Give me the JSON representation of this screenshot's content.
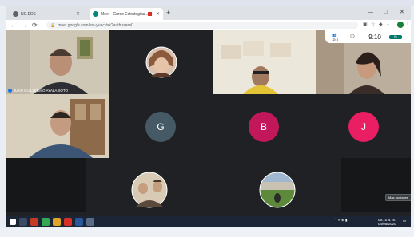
{
  "browser": {
    "tabs": [
      {
        "label": "NC.EDS",
        "active": false
      },
      {
        "label": "Meet - Curso Estrategias...",
        "active": true
      }
    ],
    "new_tab_label": "+",
    "window_controls": {
      "minimize": "—",
      "maximize": "□",
      "close": "✕"
    },
    "toolbar": {
      "back": "←",
      "forward": "→",
      "reload": "⟳",
      "url": "meet.google.com/src-yuec-tsk?authuser=0",
      "lock": "🔒"
    }
  },
  "meet": {
    "top_controls": {
      "participants_count": "(24)",
      "time": "9:10"
    },
    "participants": {
      "juan": {
        "name": "JUAN GUILLERMO AYALA SOTO"
      },
      "g": {
        "initial": "G",
        "color": "#455a64"
      },
      "b": {
        "initial": "B",
        "color": "#c2185b"
      },
      "j": {
        "initial": "J",
        "color": "#e91e63"
      }
    },
    "tooltip": "Más opciones"
  },
  "taskbar": {
    "time": "09:10 a. m.",
    "date": "04/05/2020"
  },
  "colors": {
    "meet_bg": "#202124",
    "tile_bg": "#3c4043",
    "accent_blue": "#1a73e8",
    "taskbar": "#1c2536"
  }
}
